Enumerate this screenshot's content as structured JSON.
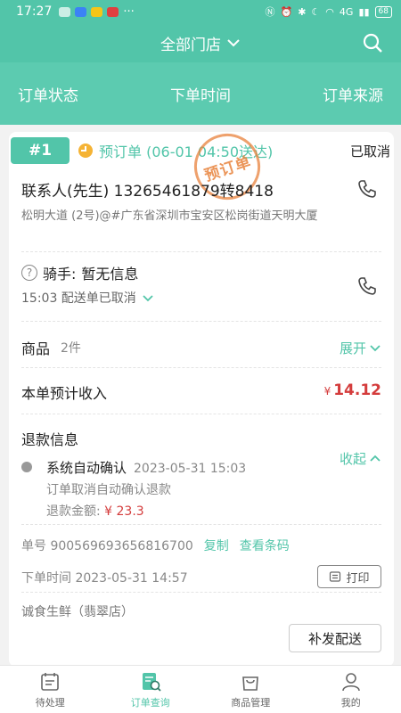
{
  "status_bar": {
    "time": "17:27",
    "network": "4G",
    "battery": "68"
  },
  "header": {
    "store_select": "全部门店"
  },
  "filters": [
    "订单状态",
    "下单时间",
    "订单来源"
  ],
  "order": {
    "index": "#1",
    "preorder_label": "预订单 (06-01 04:50送达)",
    "status": "已取消",
    "stamp_text": "预订单",
    "contact": "联系人(先生) 13265461879转8418",
    "address": "松明大道 (2号)@#广东省深圳市宝安区松岗街道天明大厦",
    "rider_label": "骑手:",
    "rider_info": "暂无信息",
    "delivery_status": "15:03 配送单已取消",
    "goods_label": "商品",
    "goods_count": "2件",
    "expand_label": "展开",
    "income_label": "本单预计收入",
    "income_currency": "¥",
    "income_value": "14.12",
    "refund_title": "退款信息",
    "collapse_label": "收起",
    "refund_event": "系统自动确认",
    "refund_time": "2023-05-31 15:03",
    "refund_desc": "订单取消自动确认退款",
    "refund_amount_label": "退款金额:",
    "refund_amount": "¥ 23.3",
    "order_no_label": "单号",
    "order_no": "900569693656816700",
    "copy_label": "复制",
    "barcode_label": "查看条码",
    "order_time_label": "下单时间",
    "order_time": "2023-05-31 14:57",
    "print_label": "打印",
    "store_name": "诚食生鲜（翡翠店）",
    "resend_label": "补发配送"
  },
  "tabbar": [
    {
      "label": "待处理",
      "icon": "calendar-icon"
    },
    {
      "label": "订单查询",
      "icon": "order-search-icon",
      "active": true
    },
    {
      "label": "商品管理",
      "icon": "bag-icon"
    },
    {
      "label": "我的",
      "icon": "user-icon"
    }
  ],
  "colors": {
    "accent": "#52c5a9",
    "price": "#d43c3c",
    "stamp": "#e8823c"
  }
}
